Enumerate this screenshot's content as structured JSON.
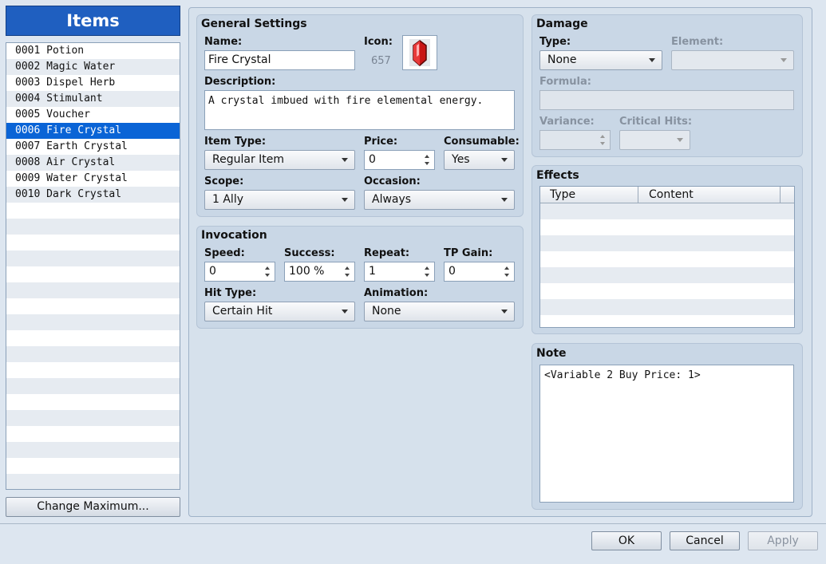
{
  "sidebar": {
    "title": "Items",
    "items": [
      "0001 Potion",
      "0002 Magic Water",
      "0003 Dispel Herb",
      "0004 Stimulant",
      "0005 Voucher",
      "0006 Fire Crystal",
      "0007 Earth Crystal",
      "0008 Air Crystal",
      "0009 Water Crystal",
      "0010 Dark Crystal"
    ],
    "selected_index": 5,
    "change_max_label": "Change Maximum..."
  },
  "general": {
    "title": "General Settings",
    "name_label": "Name:",
    "name_value": "Fire Crystal",
    "icon_label": "Icon:",
    "icon_index": "657",
    "description_label": "Description:",
    "description_value": "A crystal imbued with fire elemental energy.",
    "item_type_label": "Item Type:",
    "item_type_value": "Regular Item",
    "price_label": "Price:",
    "price_value": "0",
    "consumable_label": "Consumable:",
    "consumable_value": "Yes",
    "scope_label": "Scope:",
    "scope_value": "1 Ally",
    "occasion_label": "Occasion:",
    "occasion_value": "Always"
  },
  "invocation": {
    "title": "Invocation",
    "speed_label": "Speed:",
    "speed_value": "0",
    "success_label": "Success:",
    "success_value": "100 %",
    "repeat_label": "Repeat:",
    "repeat_value": "1",
    "tp_gain_label": "TP Gain:",
    "tp_gain_value": "0",
    "hit_type_label": "Hit Type:",
    "hit_type_value": "Certain Hit",
    "animation_label": "Animation:",
    "animation_value": "None"
  },
  "damage": {
    "title": "Damage",
    "type_label": "Type:",
    "type_value": "None",
    "element_label": "Element:",
    "element_value": "",
    "formula_label": "Formula:",
    "formula_value": "",
    "variance_label": "Variance:",
    "variance_value": "",
    "critical_label": "Critical Hits:",
    "critical_value": ""
  },
  "effects": {
    "title": "Effects",
    "columns": [
      "Type",
      "Content"
    ],
    "rows": []
  },
  "note": {
    "title": "Note",
    "value": "<Variable 2 Buy Price: 1>"
  },
  "footer": {
    "ok": "OK",
    "cancel": "Cancel",
    "apply": "Apply"
  },
  "colors": {
    "accent": "#1f5fc0",
    "selection": "#0a64d6",
    "panel": "#c9d7e6",
    "background": "#dde6f0"
  }
}
